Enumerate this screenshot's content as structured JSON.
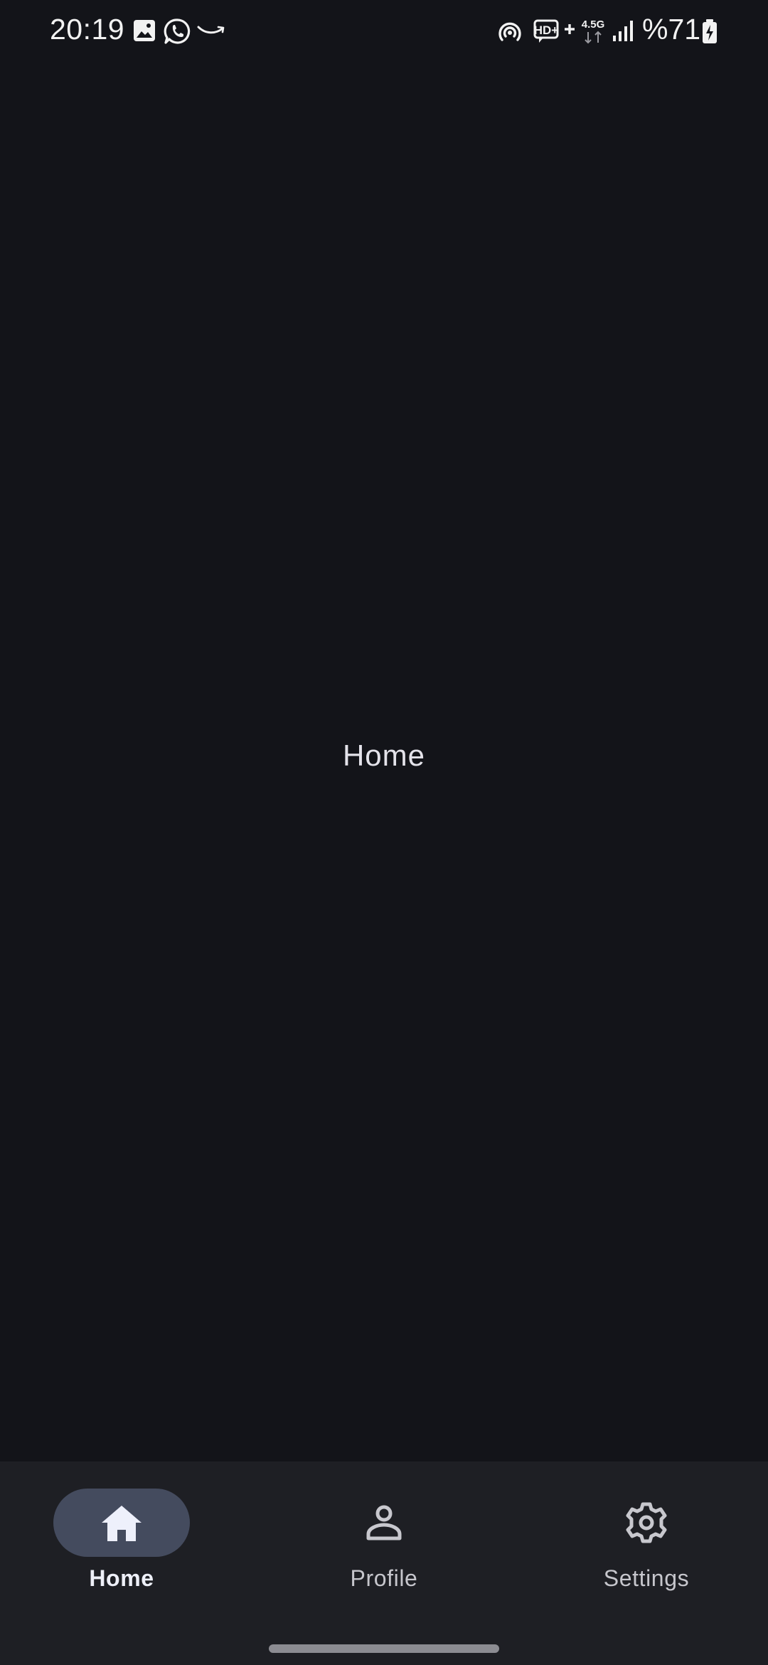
{
  "status_bar": {
    "time": "20:19",
    "left_icons": [
      "gallery-notification-icon",
      "whatsapp-notification-icon",
      "amazon-notification-icon"
    ],
    "right_icons": [
      "hotspot-icon",
      "hd-voice-icon",
      "network-type-icon",
      "signal-strength-icon",
      "battery-charging-icon"
    ],
    "hd_label": "HD+",
    "network_label": "4.5G",
    "battery": "%71"
  },
  "main": {
    "title": "Home"
  },
  "bottom_nav": {
    "active_index": 0,
    "items": [
      {
        "label": "Home",
        "icon": "home-icon",
        "active": true
      },
      {
        "label": "Profile",
        "icon": "person-icon",
        "active": false
      },
      {
        "label": "Settings",
        "icon": "gear-icon",
        "active": false
      }
    ]
  },
  "colors": {
    "background": "#131419",
    "nav_background": "#1e1f24",
    "active_pill": "#444b5e",
    "text_primary": "#e4e3ea"
  }
}
